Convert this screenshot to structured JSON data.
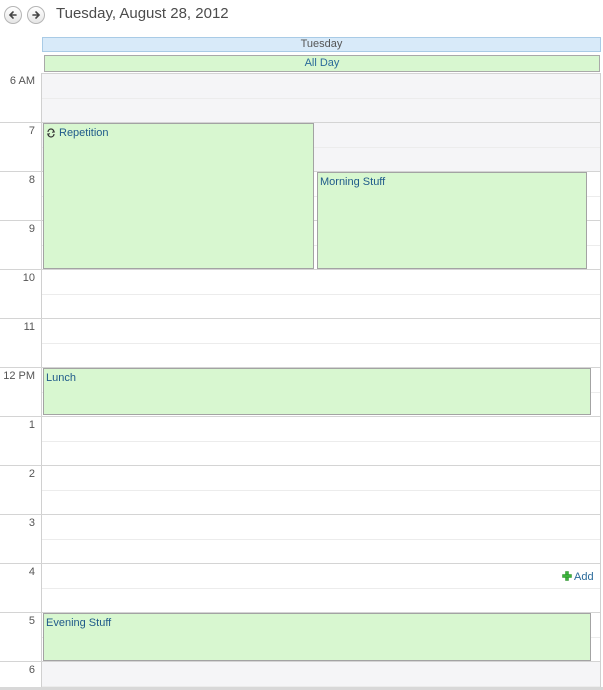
{
  "header": {
    "date_title": "Tuesday, August 28, 2012",
    "prev_icon": "arrow-left-icon",
    "next_icon": "arrow-right-icon"
  },
  "day": {
    "name": "Tuesday",
    "all_day_label": "All Day"
  },
  "time_labels": [
    "6 AM",
    "7",
    "8",
    "9",
    "10",
    "11",
    "12 PM",
    "1",
    "2",
    "3",
    "4",
    "5",
    "6"
  ],
  "events": {
    "repetition": {
      "title": "Repetition",
      "recurring": true
    },
    "morning": {
      "title": "Morning Stuff"
    },
    "lunch": {
      "title": "Lunch"
    },
    "evening": {
      "title": "Evening Stuff"
    }
  },
  "add": {
    "label": "Add",
    "icon": "plus-icon"
  },
  "colors": {
    "event_bg": "#d8f7d0",
    "event_text": "#1f5a8a",
    "header_bg": "#d8eaf9",
    "add_icon": "#3cb43c"
  }
}
